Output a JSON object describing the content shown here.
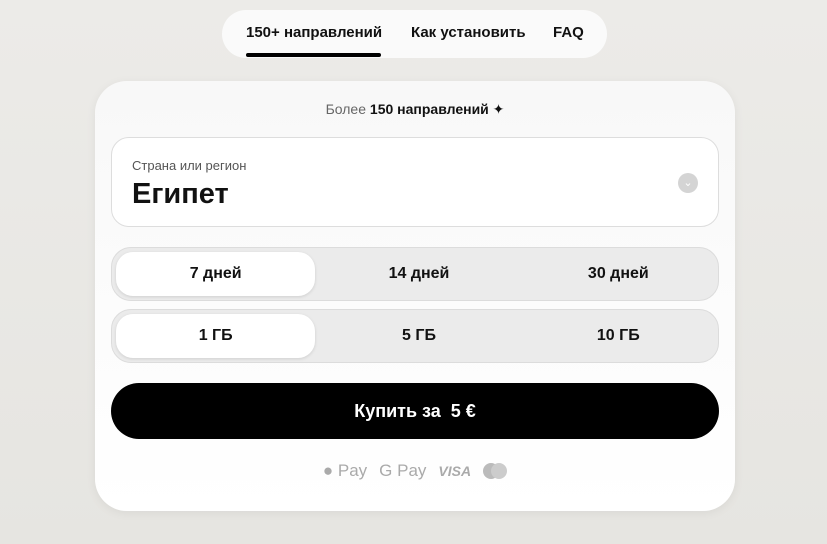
{
  "nav": {
    "tabs": [
      "150+ направлений",
      "Как установить",
      "FAQ"
    ],
    "active": 0
  },
  "card": {
    "header_prefix": "Более",
    "header_main": "150 направлений",
    "header_icon": "sparkle-icon",
    "country": {
      "label": "Страна или регион",
      "value": "Египет"
    },
    "durations": [
      "7 дней",
      "14 дней",
      "30 дней"
    ],
    "duration_selected": 0,
    "data_sizes": [
      "1 ГБ",
      "5 ГБ",
      "10 ГБ"
    ],
    "data_selected": 0,
    "buy_label": "Купить за  5 €",
    "payments": [
      "Pay",
      "G Pay",
      "VISA",
      "mastercard"
    ]
  }
}
